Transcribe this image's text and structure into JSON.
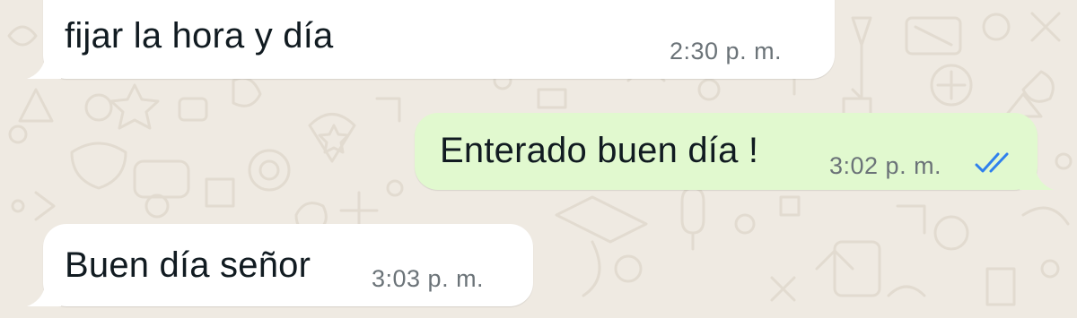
{
  "chat": {
    "background_color": "#efeae2",
    "incoming_color": "#ffffff",
    "outgoing_color": "#e1f9cf",
    "read_ticks_color": "#2f80ed",
    "messages": [
      {
        "direction": "incoming",
        "text": "fijar la hora y día",
        "time": "2:30 p. m."
      },
      {
        "direction": "outgoing",
        "text": "Enterado buen día !",
        "time": "3:02 p. m.",
        "status": "read"
      },
      {
        "direction": "incoming",
        "text": "Buen día señor",
        "time": "3:03 p. m."
      }
    ]
  }
}
